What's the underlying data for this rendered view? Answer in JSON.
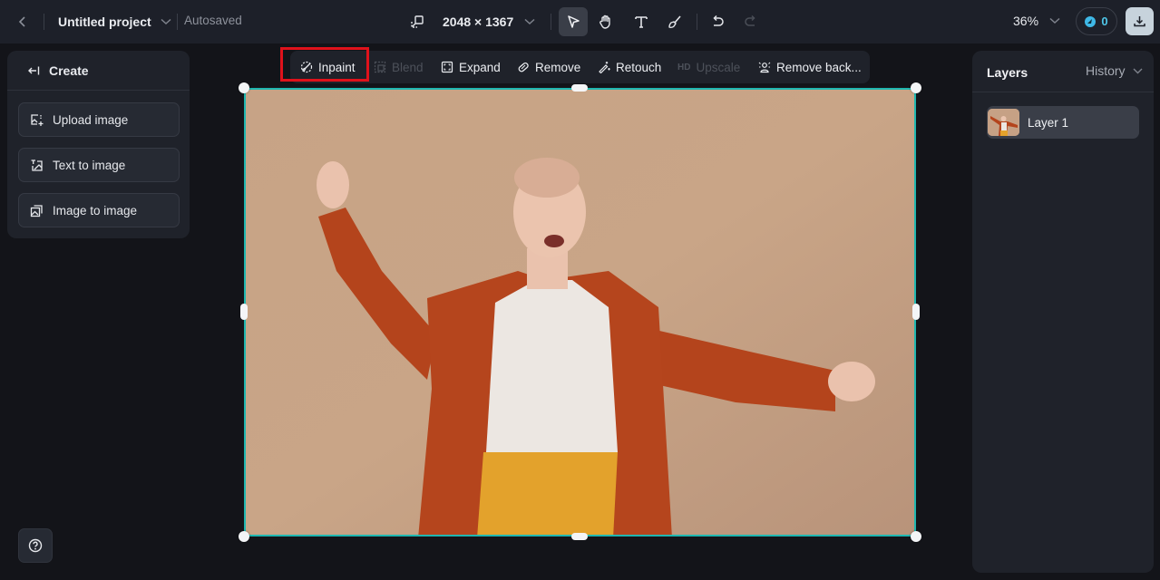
{
  "topbar": {
    "back_icon": "chevron-left-icon",
    "project_title": "Untitled project",
    "save_status": "Autosaved",
    "canvas_size": "2048 × 1367",
    "tools": [
      {
        "name": "select",
        "icon": "pointer-icon",
        "active": true
      },
      {
        "name": "hand",
        "icon": "hand-icon",
        "active": false
      },
      {
        "name": "text",
        "icon": "text-icon",
        "active": false
      },
      {
        "name": "brush",
        "icon": "brush-icon",
        "active": false
      },
      {
        "name": "undo",
        "icon": "undo-icon",
        "active": false
      },
      {
        "name": "redo",
        "icon": "redo-icon",
        "active": false,
        "disabled": true
      }
    ],
    "zoom_level": "36%",
    "credits": "0"
  },
  "left_panel": {
    "title": "Create",
    "buttons": [
      {
        "label": "Upload image",
        "icon": "upload-image-icon"
      },
      {
        "label": "Text to image",
        "icon": "text-to-image-icon"
      },
      {
        "label": "Image to image",
        "icon": "image-to-image-icon"
      }
    ]
  },
  "context_toolbar": {
    "items": [
      {
        "label": "Inpaint",
        "icon": "inpaint-icon",
        "enabled": true,
        "highlighted": true
      },
      {
        "label": "Blend",
        "icon": "blend-icon",
        "enabled": false
      },
      {
        "label": "Expand",
        "icon": "expand-icon",
        "enabled": true
      },
      {
        "label": "Remove",
        "icon": "eraser-icon",
        "enabled": true
      },
      {
        "label": "Retouch",
        "icon": "magic-wand-icon",
        "enabled": true
      },
      {
        "label": "Upscale",
        "badge": "HD",
        "enabled": false
      },
      {
        "label": "Remove back...",
        "icon": "remove-background-icon",
        "enabled": true
      }
    ]
  },
  "right_panel": {
    "tabs": {
      "layers": "Layers",
      "history": "History"
    },
    "layers": [
      {
        "name": "Layer 1"
      }
    ]
  },
  "colors": {
    "selection": "#1fb7b0",
    "highlight": "#e0121b",
    "credits_accent": "#3fb8e6"
  }
}
